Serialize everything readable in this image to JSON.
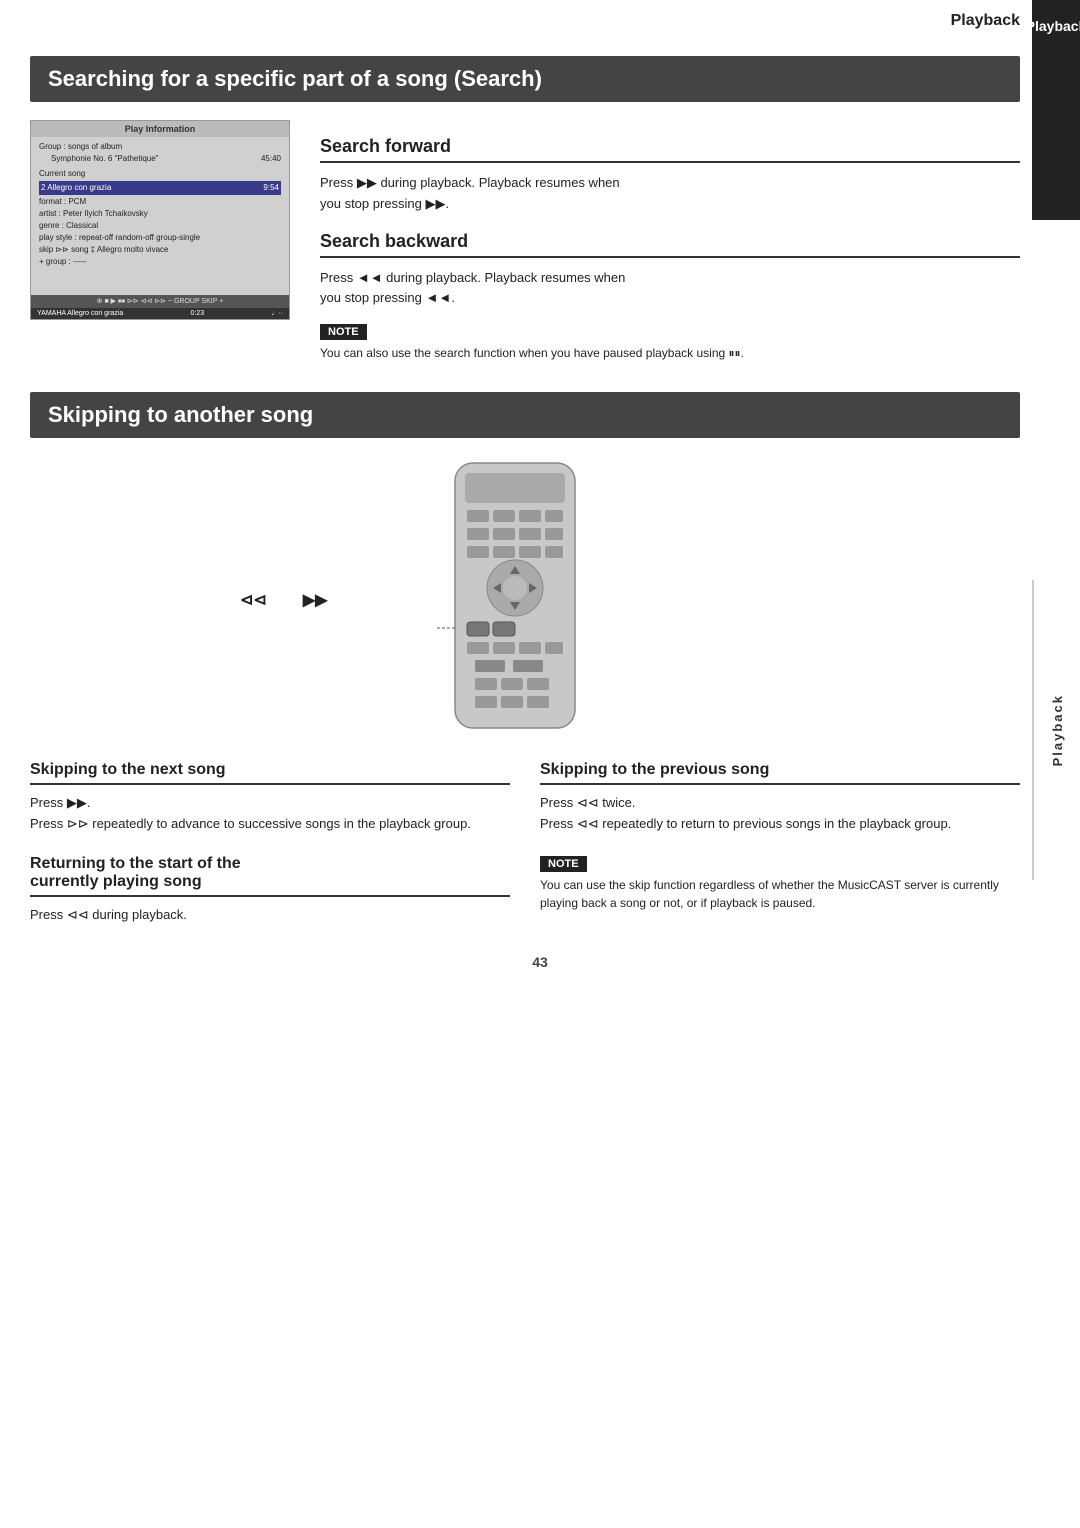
{
  "page": {
    "page_number": "43",
    "playback_label": "Playback",
    "side_tab_label": "Playback"
  },
  "search_section": {
    "title": "Searching for a specific part of a song (Search)",
    "forward": {
      "heading": "Search forward",
      "text1": "Press ▶▶ during playback. Playback resumes when",
      "text2": "you stop pressing ▶▶."
    },
    "backward": {
      "heading": "Search backward",
      "text1": "Press ◄◄ during playback. Playback resumes when",
      "text2": "you stop pressing ◄◄."
    },
    "note": {
      "label": "NOTE",
      "text": "You can also use the search function when you have paused playback using ⏸⏸."
    },
    "screen": {
      "title": "Play Information",
      "group_label": "Group : songs of album",
      "album_name": "Symphonie No. 6 \"Pathetique\"",
      "album_time": "45:40",
      "current_song_label": "Current song",
      "song_entry": "2  Allegro con grazia",
      "song_time": "9:54",
      "format_label": "format : PCM",
      "artist_label": "artist : Peter Ilyich Tchaikovsky",
      "genre_label": "genre : Classical",
      "play_style_label": "play style : repeat-off   random-off   group-single",
      "skip_label": "skip ⊳⊳  song ‡ Allegro molto vivace",
      "group_skip_label": "+ group : -----",
      "nav_bar": "⊕ ■  ▶  ⏹⏹  ⊳⊳  ⊲⊲  ⊳⊳  ~  GROUP SKIP +",
      "bottom_left": "YAMAHA  Allegro con grazia",
      "bottom_time": "0:23",
      "bottom_icon": "♩··"
    }
  },
  "skip_section": {
    "title": "Skipping to another song",
    "next_song": {
      "heading": "Skipping to the next song",
      "text1": "Press ▶▶.",
      "text2": "Press ⊳⊳ repeatedly to advance to successive songs in the playback group."
    },
    "previous_song": {
      "heading": "Skipping to the previous song",
      "text1": "Press ⊲⊲ twice.",
      "text2": "Press ⊲⊲ repeatedly to return to previous songs in the playback group."
    },
    "returning": {
      "heading1": "Returning to the start of the",
      "heading2": "currently playing song",
      "text": "Press ⊲⊲ during playback."
    },
    "note": {
      "label": "NOTE",
      "text": "You can use the skip function regardless of whether the MusicCAST server is currently playing back a song or not, or if playback is paused."
    },
    "remote_label_left": "⊲⊲",
    "remote_label_right": "▶▶"
  }
}
